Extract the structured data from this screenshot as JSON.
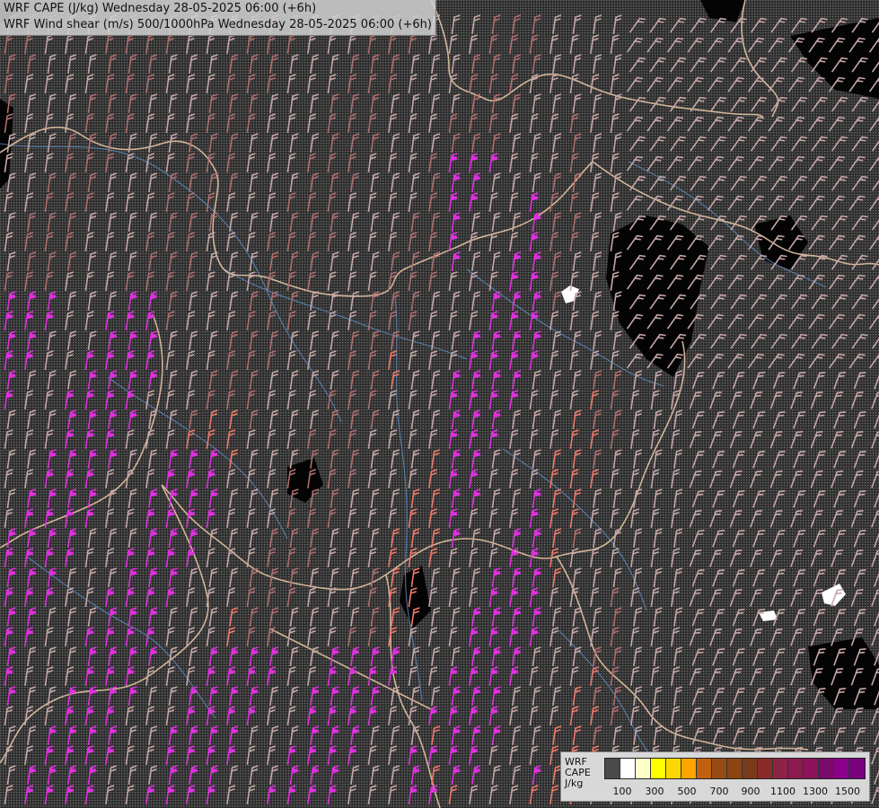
{
  "title": {
    "line1": "WRF CAPE (J/kg) Wednesday 28-05-2025 06:00 (+6h)",
    "line2": "WRF Wind shear (m/s) 500/1000hPa Wednesday 28-05-2025 06:00 (+6h)"
  },
  "legend": {
    "caption": [
      "WRF",
      "CAPE",
      "J/kg"
    ],
    "tick_labels": [
      "100",
      "300",
      "500",
      "700",
      "900",
      "1100",
      "1300",
      "1500"
    ],
    "swatch_colors": [
      "#4a4a4a",
      "#ffffff",
      "#ffffc8",
      "#ffff00",
      "#ffd700",
      "#ffa500",
      "#c06010",
      "#964b14",
      "#8b4513",
      "#7a3a1a",
      "#8b2a2a",
      "#8c2345",
      "#8b1a4e",
      "#8b135a",
      "#7a0a6a",
      "#8b008b",
      "#7a0080"
    ]
  },
  "colors": {
    "background": "#3a3a3a",
    "border_line": "#e3c3a2",
    "river_line": "#5f8fc9",
    "barb_low": "#c7a7a7",
    "barb_mid": "#b06e6e",
    "barb_high": "#f07a6a",
    "barb_very_high": "#e030e0",
    "cape_zero": "#000000",
    "cape_low": "#ffffff"
  }
}
